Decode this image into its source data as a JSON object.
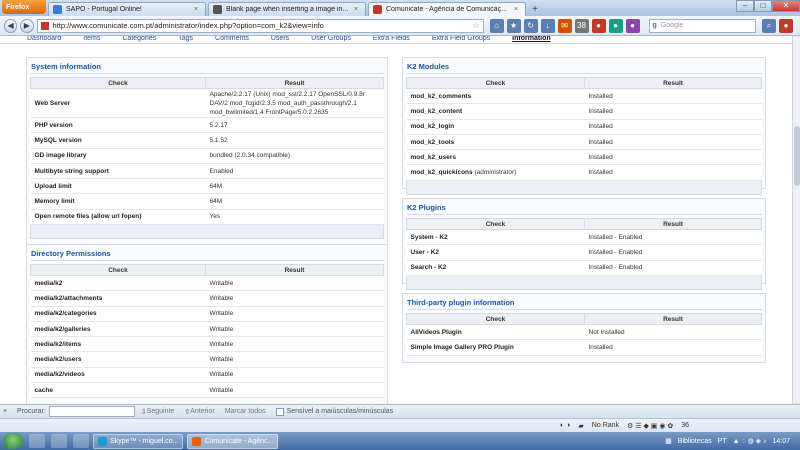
{
  "browser": {
    "menu_button": "Firefox",
    "tabs": [
      {
        "label": "SAPO - Portugal Online!",
        "color": "#3a7bd5"
      },
      {
        "label": "Blank page when inserting a image in...",
        "color": "#555555"
      },
      {
        "label": "Comunicate - Agência de Comunicaç...",
        "color": "#c0392b",
        "active": true
      }
    ],
    "url": "http://www.comunicate.com.pt/administrator/index.php?option=com_k2&view=info",
    "search_engine": "Google",
    "download_badge": "38"
  },
  "k2_nav": [
    "Dashboard",
    "Items",
    "Categories",
    "Tags",
    "Comments",
    "Users",
    "User Groups",
    "Extra Fields",
    "Extra Field Groups",
    "Information"
  ],
  "system_info": {
    "title": "System information",
    "col_check": "Check",
    "col_result": "Result",
    "rows": [
      {
        "check": "Web Server",
        "result": "Apache/2.2.17 (Unix) mod_ssl/2.2.17 OpenSSL/0.9.8r DAV/2 mod_fcgid/2.3.5 mod_auth_passthrough/2.1 mod_bwlimited/1.4 FrontPage/5.0.2.2635"
      },
      {
        "check": "PHP version",
        "result": "5.2.17"
      },
      {
        "check": "MySQL version",
        "result": "5.1.52"
      },
      {
        "check": "GD image library",
        "result": "bundled (2.0.34 compatible)"
      },
      {
        "check": "Multibyte string support",
        "result": "Enabled"
      },
      {
        "check": "Upload limit",
        "result": "64M"
      },
      {
        "check": "Memory limit",
        "result": "64M"
      },
      {
        "check": "Open remote files (allow url fopen)",
        "result": "Yes"
      }
    ]
  },
  "dir_permissions": {
    "title": "Directory Permissions",
    "col_check": "Check",
    "col_result": "Result",
    "rows": [
      {
        "check": "media/k2",
        "result": "Writable"
      },
      {
        "check": "media/k2/attachments",
        "result": "Writable"
      },
      {
        "check": "media/k2/categories",
        "result": "Writable"
      },
      {
        "check": "media/k2/galleries",
        "result": "Writable"
      },
      {
        "check": "media/k2/items",
        "result": "Writable"
      },
      {
        "check": "media/k2/users",
        "result": "Writable"
      },
      {
        "check": "media/k2/videos",
        "result": "Writable"
      },
      {
        "check": "cache",
        "result": "Writable"
      }
    ]
  },
  "k2_modules": {
    "title": "K2 Modules",
    "col_check": "Check",
    "col_result": "Result",
    "rows": [
      {
        "check": "mod_k2_comments",
        "note": "",
        "result": "Installed"
      },
      {
        "check": "mod_k2_content",
        "note": "",
        "result": "Installed"
      },
      {
        "check": "mod_k2_login",
        "note": "",
        "result": "Installed"
      },
      {
        "check": "mod_k2_tools",
        "note": "",
        "result": "Installed"
      },
      {
        "check": "mod_k2_users",
        "note": "",
        "result": "Installed"
      },
      {
        "check": "mod_k2_quickicons",
        "note": "(administrator)",
        "result": "Installed"
      }
    ]
  },
  "k2_plugins": {
    "title": "K2 Plugins",
    "col_check": "Check",
    "col_result": "Result",
    "rows": [
      {
        "check": "System - K2",
        "result": "Installed - Enabled"
      },
      {
        "check": "User - K2",
        "result": "Installed - Enabled"
      },
      {
        "check": "Search - K2",
        "result": "Installed - Enabled"
      }
    ]
  },
  "third_party": {
    "title": "Third-party plugin information",
    "col_check": "Check",
    "col_result": "Result",
    "rows": [
      {
        "check": "AllVideos Plugin",
        "result": "Not Installed"
      },
      {
        "check": "Simple Image Gallery PRO Plugin",
        "result": "Installed"
      }
    ]
  },
  "findbar": {
    "label": "Procurar:",
    "next": "Seguinte",
    "prev": "Anterior",
    "highlight": "Marcar todos",
    "match_case": "Sensível a maiúsculas/minúsculas"
  },
  "addonbar": {
    "rank": "No Rank",
    "count": "36"
  },
  "taskbar": {
    "tasks": [
      {
        "label": "Skype™ - miguel.co...",
        "color": "#1a9cd8"
      },
      {
        "label": "Comunicate - Agênc...",
        "color": "#e0650c",
        "active": true
      }
    ],
    "libraries": "Bibliotecas",
    "lang": "PT",
    "time": "14:07"
  }
}
